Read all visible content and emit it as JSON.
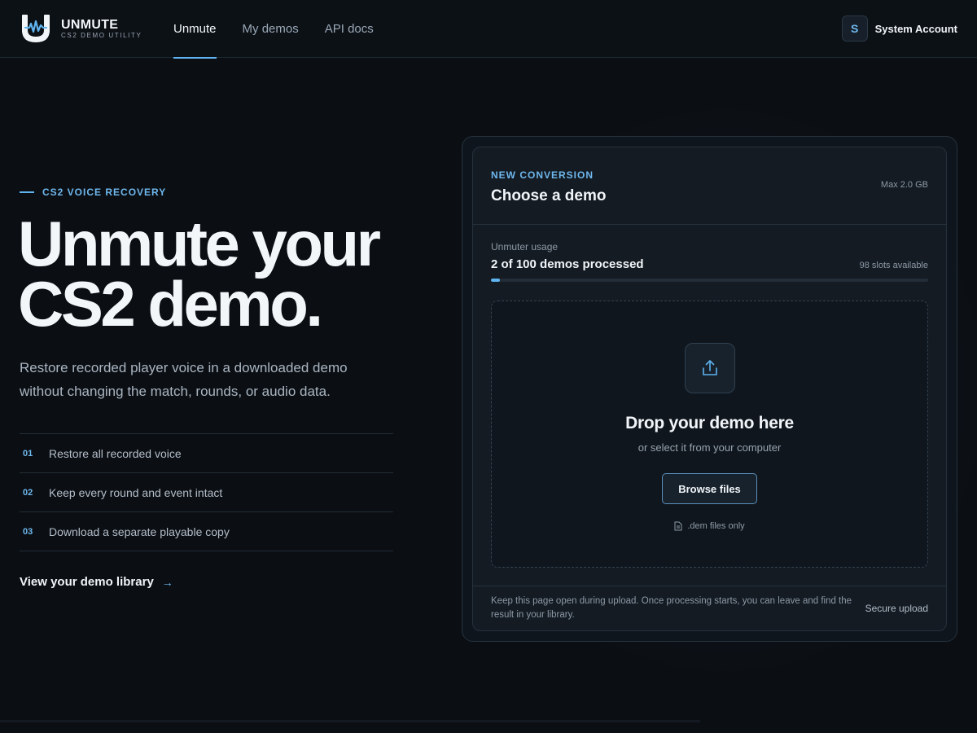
{
  "header": {
    "logo_title": "UNMUTE",
    "logo_subtitle": "CS2 DEMO UTILITY",
    "nav": [
      {
        "label": "Unmute",
        "active": true
      },
      {
        "label": "My demos",
        "active": false
      },
      {
        "label": "API docs",
        "active": false
      }
    ],
    "account": {
      "initial": "S",
      "name": "System Account"
    }
  },
  "hero": {
    "eyebrow": "CS2 VOICE RECOVERY",
    "title_line1": "Unmute your",
    "title_line2": "CS2 demo.",
    "description": "Restore recorded player voice in a downloaded demo without changing the match, rounds, or audio data.",
    "features": [
      {
        "num": "01",
        "text": "Restore all recorded voice"
      },
      {
        "num": "02",
        "text": "Keep every round and event intact"
      },
      {
        "num": "03",
        "text": "Download a separate playable copy"
      }
    ],
    "library_link": "View your demo library",
    "library_arrow": "→"
  },
  "card": {
    "eyebrow": "NEW CONVERSION",
    "title": "Choose a demo",
    "max_size": "Max 2.0 GB",
    "usage": {
      "label": "Unmuter usage",
      "count": "2 of 100 demos processed",
      "slots": "98 slots available",
      "fraction": 0.02
    },
    "dropzone": {
      "title": "Drop your demo here",
      "subtitle": "or select it from your computer",
      "button": "Browse files",
      "hint": ".dem files only"
    },
    "footer": {
      "note": "Keep this page open during upload. Once processing starts, you can leave and find the result in your library.",
      "secure": "Secure upload"
    }
  },
  "colors": {
    "background": "#0b0f14",
    "accent": "#5fb3ef",
    "card": "#141b23"
  },
  "icons": {
    "logo": "unmute-logo-icon",
    "upload": "upload-icon",
    "file": "file-icon",
    "arrow": "arrow-right-icon"
  }
}
